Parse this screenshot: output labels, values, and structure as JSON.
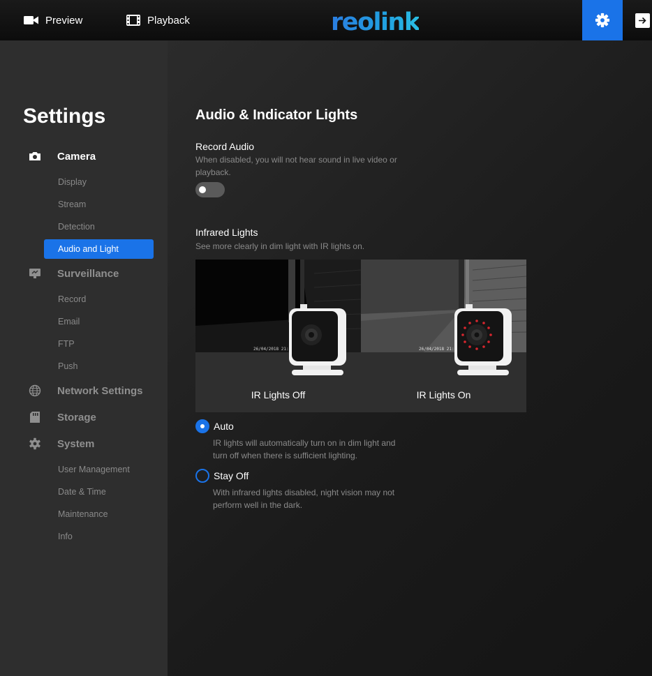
{
  "topbar": {
    "preview_label": "Preview",
    "playback_label": "Playback",
    "logo_text": "reolink",
    "icons": {
      "preview": "video-camera-icon",
      "playback": "film-strip-icon",
      "settings": "gear-icon",
      "logout": "logout-arrow-icon"
    },
    "accent_color": "#1a73e8"
  },
  "sidebar": {
    "title": "Settings",
    "groups": [
      {
        "label": "Camera",
        "icon": "camera-icon",
        "items": [
          "Display",
          "Stream",
          "Detection",
          "Audio and Light"
        ]
      },
      {
        "label": "Surveillance",
        "icon": "monitor-icon",
        "items": [
          "Record",
          "Email",
          "FTP",
          "Push"
        ]
      },
      {
        "label": "Network Settings",
        "icon": "globe-icon",
        "items": []
      },
      {
        "label": "Storage",
        "icon": "sd-card-icon",
        "items": []
      },
      {
        "label": "System",
        "icon": "gear-icon",
        "items": [
          "User Management",
          "Date & Time",
          "Maintenance",
          "Info"
        ]
      }
    ],
    "active_item": "Audio and Light"
  },
  "main": {
    "title": "Audio & Indicator Lights",
    "record_audio": {
      "title": "Record Audio",
      "desc": "When disabled, you will not hear sound in live video or playback.",
      "enabled": false
    },
    "infrared": {
      "title": "Infrared Lights",
      "desc": "See more clearly in dim light with IR lights on.",
      "preview_off_label": "IR Lights Off",
      "preview_on_label": "IR Lights On",
      "timestamp": "26/04/2018 21:40",
      "options": [
        {
          "label": "Auto",
          "desc": "IR lights will automatically turn on in dim light and turn off when there is sufficient lighting.",
          "selected": true
        },
        {
          "label": "Stay Off",
          "desc": "With infrared lights disabled, night vision may not perform well in the dark.",
          "selected": false
        }
      ]
    }
  }
}
